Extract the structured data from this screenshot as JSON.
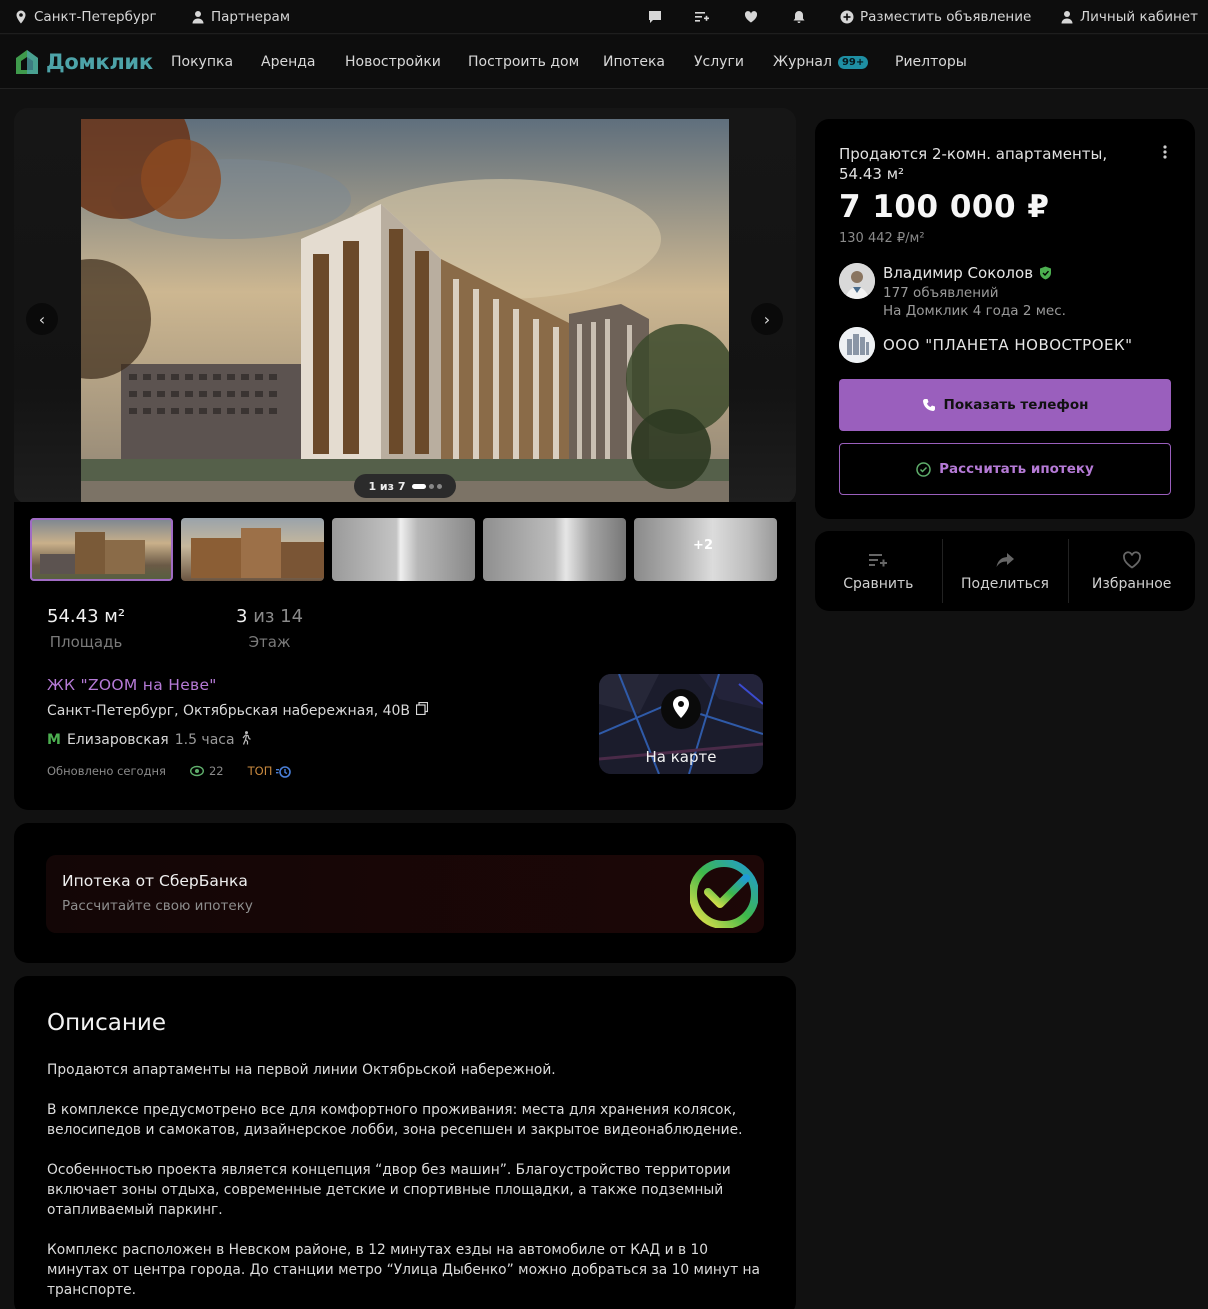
{
  "topbar": {
    "city": "Санкт-Петербург",
    "partners": "Партнерам",
    "post_ad": "Разместить объявление",
    "cabinet": "Личный кабинет"
  },
  "nav": {
    "logo": "Домклик",
    "items": [
      "Покупка",
      "Аренда",
      "Новостройки",
      "Построить дом",
      "Ипотека",
      "Услуги",
      "Журнал",
      "Риелторы"
    ],
    "journal_badge": "99+"
  },
  "gallery": {
    "counter": "1 из 7",
    "more_photos": "+2"
  },
  "listing": {
    "area_value": "54.43 м²",
    "area_label": "Площадь",
    "floor_current": "3",
    "floor_rest": "из 14",
    "floor_label": "Этаж",
    "complex": "ЖК \"ZOOM на Неве\"",
    "address": "Санкт-Петербург, Октябрьская набережная, 40В",
    "metro": "Елизаровская",
    "metro_time": "1.5 часа",
    "updated": "Обновлено сегодня",
    "views": "22",
    "top": "ТОП",
    "map_label": "На карте"
  },
  "offer": {
    "title": "Продаются 2-комн. апартаменты, 54.43 м²",
    "price": "7 100 000 ₽",
    "price_per_m": "130 442 ₽/м²",
    "agent_name": "Владимир Соколов",
    "agent_ads": "177 объявлений",
    "agent_since": "На Домклик 4 года 2 мес.",
    "agency": "ООО \"ПЛАНЕТА НОВОСТРОЕК\"",
    "show_phone": "Показать телефон",
    "calc_mortgage": "Рассчитать ипотеку"
  },
  "actions": {
    "compare": "Сравнить",
    "share": "Поделиться",
    "favorite": "Избранное"
  },
  "sber": {
    "title": "Ипотека от СберБанка",
    "subtitle": "Рассчитайте свою ипотеку"
  },
  "description": {
    "heading": "Описание",
    "paragraphs": [
      "Продаются апартаменты на первой линии Октябрьской набережной.",
      "В комплексе предусмотрено все для комфортного проживания: места для хранения колясок, велосипедов и самокатов, дизайнерское лобби, зона ресепшен и закрытое видеонаблюдение.",
      "Особенностью проекта является концепция “двор без машин”. Благоустройство территории включает зоны отдыха, современные детские и спортивные площадки, а также подземный отапливаемый паркинг.",
      "Комплекс расположен в Невском районе, в 12 минутах езды на автомобиле от КАД и в 10 минутах от центра города. До станции метро “Улица Дыбенко” можно добраться за 10 минут на транспорте."
    ]
  },
  "colors": {
    "accent": "#9a5fbd",
    "link": "#b57ad6",
    "brand": "#4da3a8"
  }
}
